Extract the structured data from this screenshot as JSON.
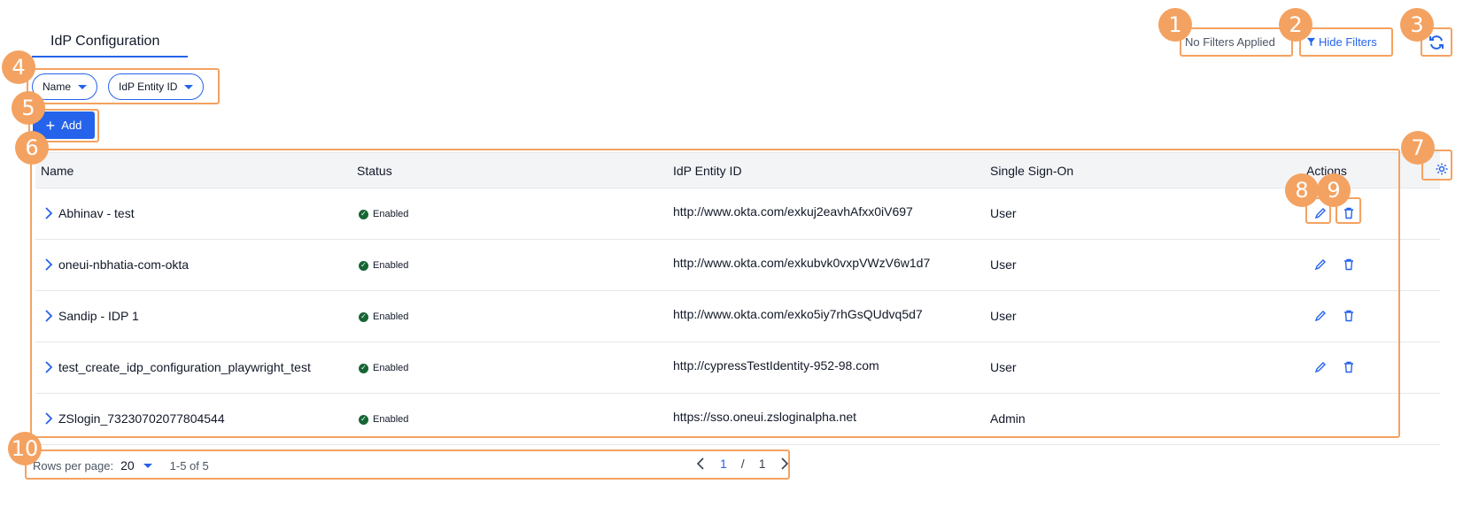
{
  "tab": {
    "label": "IdP Configuration"
  },
  "toolbar": {
    "no_filters_label": "No Filters Applied",
    "hide_filters_label": "Hide Filters"
  },
  "filters": [
    {
      "label": "Name"
    },
    {
      "label": "IdP Entity ID"
    }
  ],
  "add_button": {
    "label": "Add"
  },
  "table": {
    "headers": [
      "Name",
      "Status",
      "IdP Entity ID",
      "Single Sign-On",
      "Actions"
    ],
    "rows": [
      {
        "name": "Abhinav - test",
        "status": "Enabled",
        "entity_id": "http://www.okta.com/exkuj2eavhAfxx0iV697",
        "sso": "User",
        "actions": true
      },
      {
        "name": "oneui-nbhatia-com-okta",
        "status": "Enabled",
        "entity_id": "http://www.okta.com/exkubvk0vxpVWzV6w1d7",
        "sso": "User",
        "actions": true
      },
      {
        "name": "Sandip - IDP 1",
        "status": "Enabled",
        "entity_id": "http://www.okta.com/exko5iy7rhGsQUdvq5d7",
        "sso": "User",
        "actions": true
      },
      {
        "name": "test_create_idp_configuration_playwright_test",
        "status": "Enabled",
        "entity_id": "http://cypressTestIdentity-952-98.com",
        "sso": "User",
        "actions": true
      },
      {
        "name": "ZSlogin_73230702077804544",
        "status": "Enabled",
        "entity_id": "https://sso.oneui.zsloginalpha.net",
        "sso": "Admin",
        "actions": false
      }
    ]
  },
  "pagination": {
    "rows_per_page_label": "Rows per page:",
    "rows_per_page_value": "20",
    "range": "1-5 of 5",
    "current_page": "1",
    "separator": "/",
    "total_pages": "1"
  },
  "annotations": [
    "1",
    "2",
    "3",
    "4",
    "5",
    "6",
    "7",
    "8",
    "9",
    "10"
  ],
  "colors": {
    "accent": "#2563eb",
    "annotation": "#f4a261",
    "enabled": "#166534"
  }
}
